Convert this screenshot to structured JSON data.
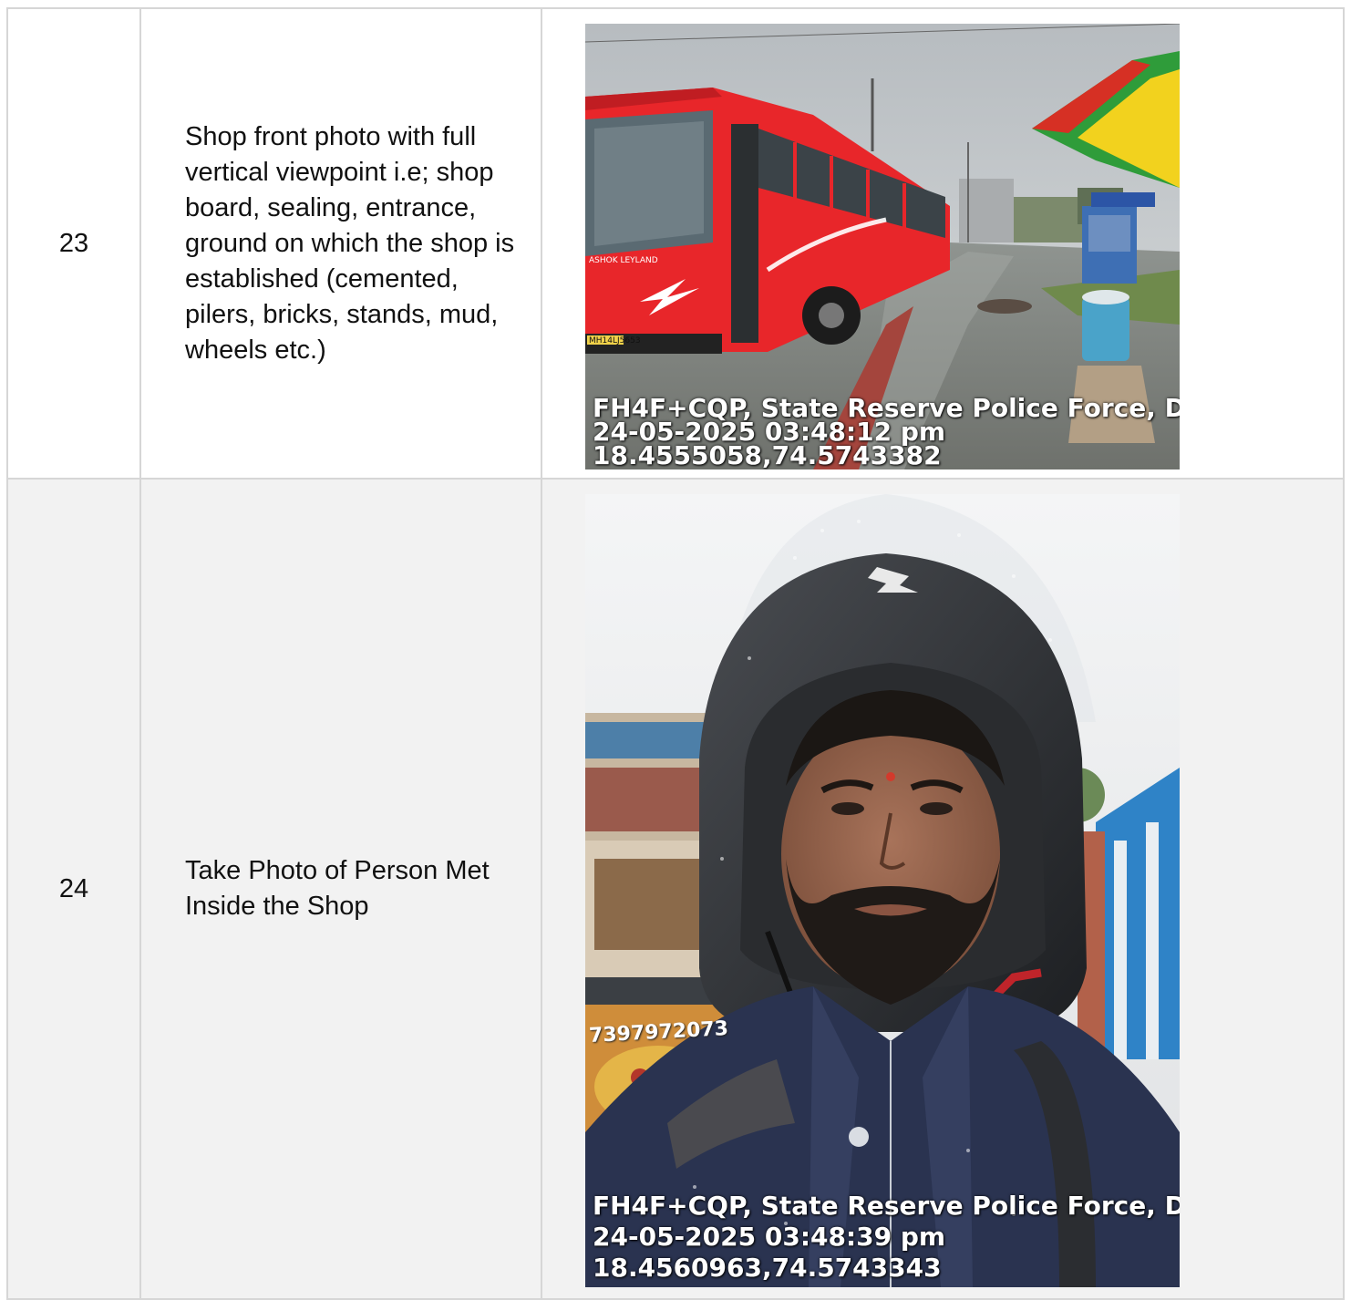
{
  "rows": [
    {
      "number": "23",
      "description": "Shop front photo with full vertical viewpoint i.e; shop board, sealing, entrance, ground on which the shop is established (cemented, pilers, bricks, stands, mud, wheels etc.)",
      "photo": {
        "subject": "street-bus",
        "stamp": {
          "location": "FH4F+CQP, State Reserve Police Force, D",
          "datetime": "24-05-2025 03:48:12 pm",
          "coordinates": "18.4555058,74.5743382"
        },
        "bus_brand": "ASHOK LEYLAND",
        "plate": "MH14LJ5653"
      }
    },
    {
      "number": "24",
      "description": "Take Photo of Person Met Inside the Shop",
      "photo": {
        "subject": "person-with-helmet",
        "stamp": {
          "location": "FH4F+CQP, State Reserve Police Force, D",
          "datetime": "24-05-2025 03:48:39 pm",
          "coordinates": "18.4560963,74.5743343"
        },
        "sign_phone": "7397972073"
      }
    }
  ],
  "colors": {
    "border": "#d6d6d6",
    "row_alt_background": "#f2f2f2",
    "bus_red": "#e8262a",
    "jacket_navy": "#2a3350"
  }
}
